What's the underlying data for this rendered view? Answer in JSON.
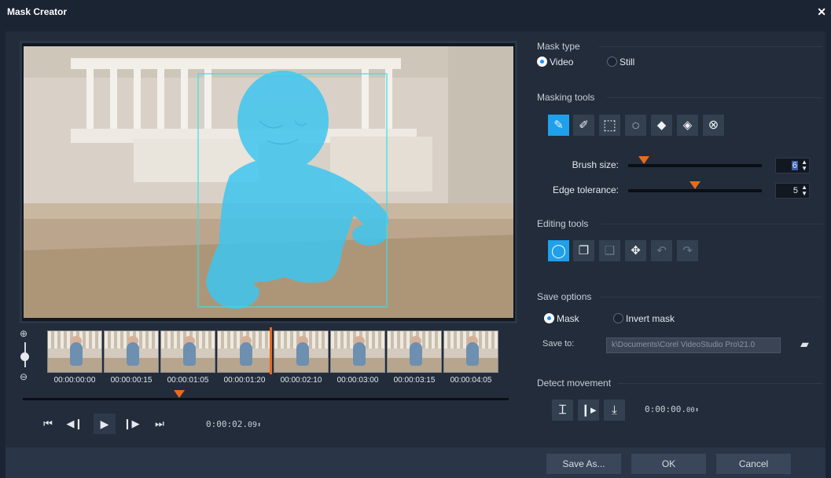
{
  "window": {
    "title": "Mask Creator",
    "close_glyph": "✕"
  },
  "filmstrip": {
    "timecodes": [
      "00:00:00:00",
      "00:00:00:15",
      "00:00:01:05",
      "00:00:01:20",
      "00:00:02:10",
      "00:00:03:00",
      "00:00:03:15",
      "00:00:04:05"
    ]
  },
  "zoom": {
    "in_icon": "zoom-in-icon",
    "out_icon": "zoom-out-icon"
  },
  "transport": {
    "timecode": "0:00:02.",
    "timecode_frames": "09"
  },
  "mask_type": {
    "title": "Mask type",
    "options": [
      {
        "label": "Video",
        "selected": true
      },
      {
        "label": "Still",
        "selected": false
      }
    ]
  },
  "masking_tools": {
    "title": "Masking tools",
    "tools": [
      "brush-icon",
      "smart-brush-icon",
      "rectangle-select-icon",
      "ellipse-select-icon",
      "eraser-icon",
      "smart-eraser-icon",
      "clear-mask-icon"
    ],
    "brush_size_label": "Brush size:",
    "brush_size_value": "6",
    "brush_size_fraction": 0.12,
    "edge_tolerance_label": "Edge tolerance:",
    "edge_tolerance_value": "5",
    "edge_tolerance_fraction": 0.5
  },
  "editing_tools": {
    "title": "Editing tools",
    "tools": [
      "lasso-icon",
      "copy-icon",
      "paste-icon",
      "move-icon",
      "undo-icon",
      "redo-icon"
    ]
  },
  "save_options": {
    "title": "Save options",
    "options": [
      {
        "label": "Mask",
        "selected": true
      },
      {
        "label": "Invert mask",
        "selected": false
      }
    ],
    "save_to_label": "Save to:",
    "save_to_path": "k\\Documents\\Corel VideoStudio Pro\\21.0"
  },
  "detect_movement": {
    "title": "Detect movement",
    "tools": [
      "track-frame-icon",
      "track-next-icon",
      "track-to-end-icon"
    ],
    "timecode": "0:00:00.",
    "timecode_frames": "00"
  },
  "buttons": {
    "save_as": "Save As...",
    "ok": "OK",
    "cancel": "Cancel"
  },
  "colors": {
    "accent": "#1ea0ea",
    "marker": "#e86a1f",
    "mask_overlay": "#3ec6f0",
    "selection_box": "#37e0e6"
  }
}
